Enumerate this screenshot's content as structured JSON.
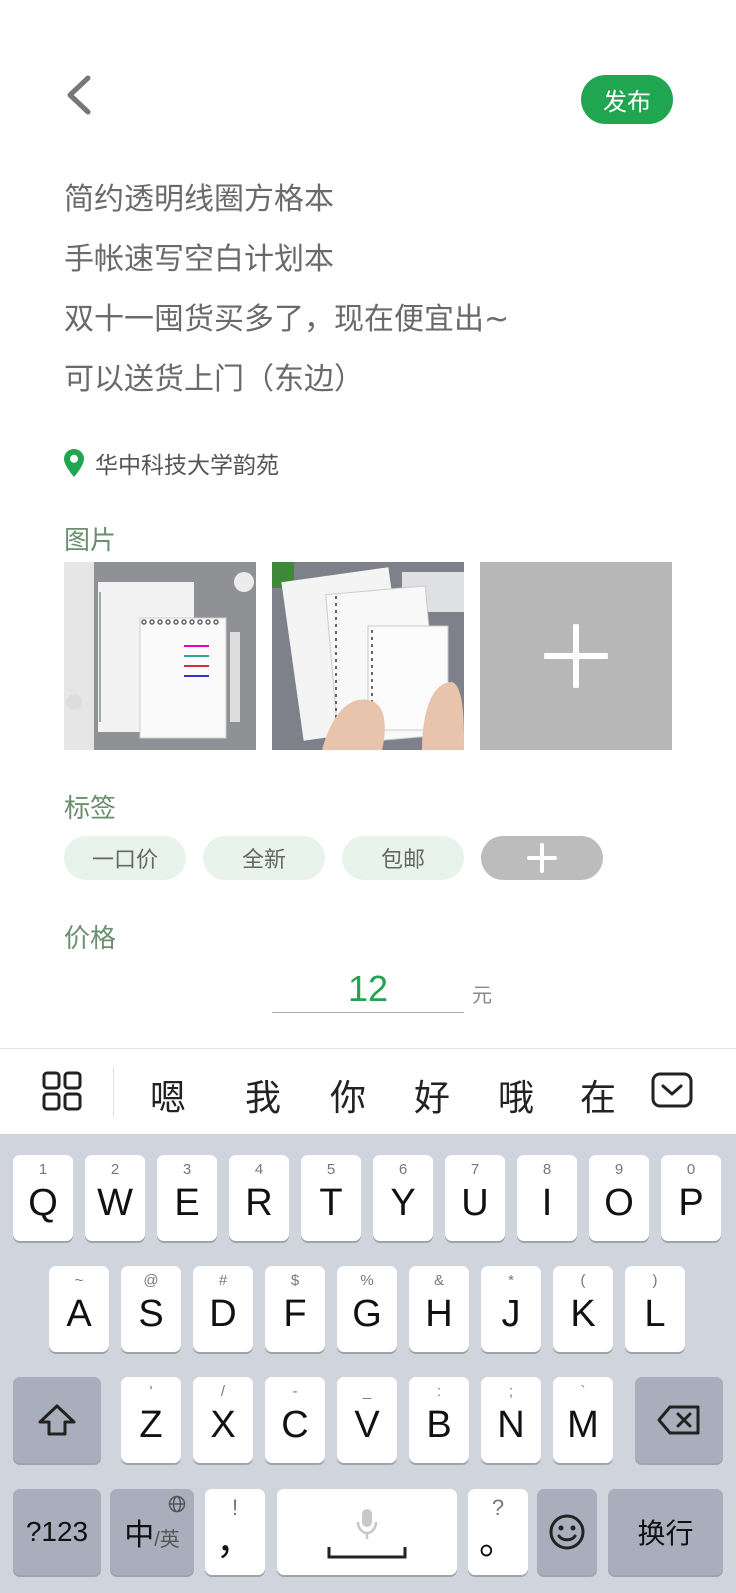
{
  "header": {
    "publish_label": "发布",
    "back_icon": "chevron-left-icon"
  },
  "description": {
    "lines": [
      "简约透明线圈方格本",
      "手帐速写空白计划本",
      "双十一囤货买多了，现在便宜出~",
      "可以送货上门（东边）"
    ]
  },
  "location": {
    "text": "华中科技大学韵苑",
    "icon": "location-pin-icon",
    "color": "#20a650"
  },
  "photos": {
    "label": "图片",
    "add_icon": "plus-icon"
  },
  "tags": {
    "label": "标签",
    "items": [
      "一口价",
      "全新",
      "包邮"
    ],
    "add_icon": "plus-icon"
  },
  "price": {
    "label": "价格",
    "value": "12",
    "unit": "元"
  },
  "candidates": {
    "words": [
      "嗯",
      "我",
      "你",
      "好",
      "哦",
      "在"
    ],
    "menu_icon": "grid-icon",
    "collapse_icon": "keyboard-collapse-icon"
  },
  "keyboard": {
    "row1": [
      {
        "sub": "1",
        "key": "Q"
      },
      {
        "sub": "2",
        "key": "W"
      },
      {
        "sub": "3",
        "key": "E"
      },
      {
        "sub": "4",
        "key": "R"
      },
      {
        "sub": "5",
        "key": "T"
      },
      {
        "sub": "6",
        "key": "Y"
      },
      {
        "sub": "7",
        "key": "U"
      },
      {
        "sub": "8",
        "key": "I"
      },
      {
        "sub": "9",
        "key": "O"
      },
      {
        "sub": "0",
        "key": "P"
      }
    ],
    "row2": [
      {
        "sub": "~",
        "key": "A"
      },
      {
        "sub": "@",
        "key": "S"
      },
      {
        "sub": "#",
        "key": "D"
      },
      {
        "sub": "$",
        "key": "F"
      },
      {
        "sub": "%",
        "key": "G"
      },
      {
        "sub": "&",
        "key": "H"
      },
      {
        "sub": "*",
        "key": "J"
      },
      {
        "sub": "(",
        "key": "K"
      },
      {
        "sub": ")",
        "key": "L"
      }
    ],
    "row3": [
      {
        "sub": "'",
        "key": "Z"
      },
      {
        "sub": "/",
        "key": "X"
      },
      {
        "sub": "-",
        "key": "C"
      },
      {
        "sub": "_",
        "key": "V"
      },
      {
        "sub": ":",
        "key": "B"
      },
      {
        "sub": ";",
        "key": "N"
      },
      {
        "sub": "`",
        "key": "M"
      }
    ],
    "numbers_label": "?123",
    "lang_main": "中",
    "lang_sub": "/英",
    "comma_sub": "!",
    "comma_key": "，",
    "period_sub": "?",
    "period_key": "。",
    "enter_label": "换行",
    "shift_icon": "shift-icon",
    "backspace_icon": "backspace-icon",
    "mic_icon": "microphone-icon",
    "emoji_icon": "emoji-icon",
    "globe_icon": "globe-icon"
  }
}
